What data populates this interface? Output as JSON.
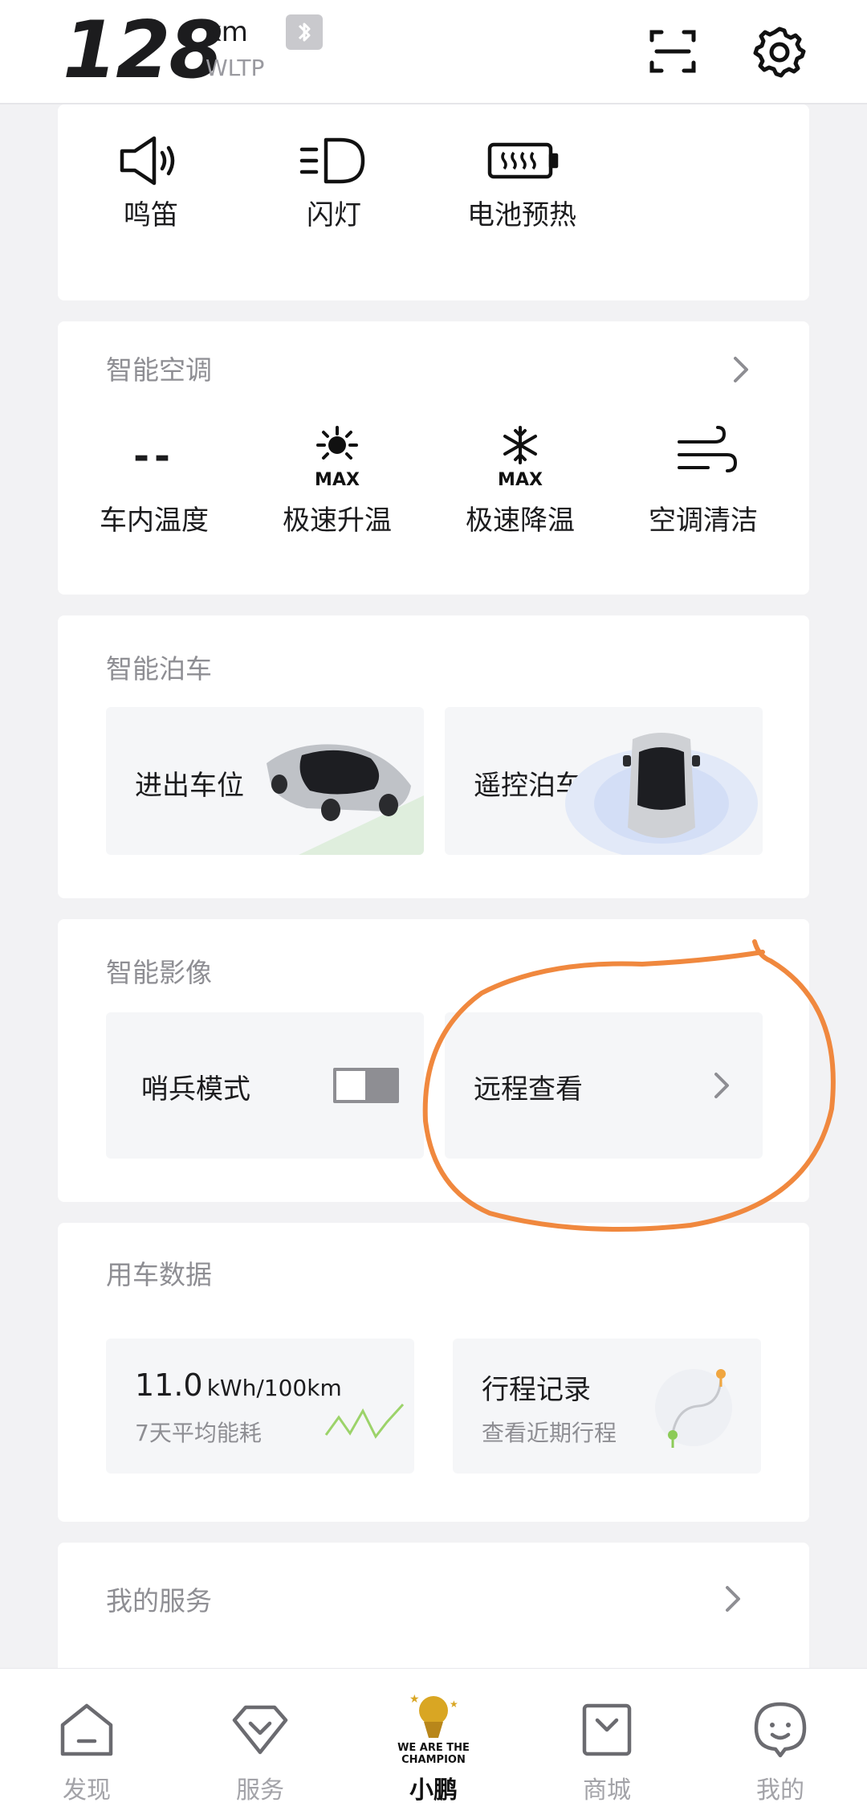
{
  "status": {
    "range_value": "128",
    "range_unit": "km",
    "range_standard": "WLTP"
  },
  "quick_actions": [
    {
      "label": "鸣笛",
      "icon": "horn-icon"
    },
    {
      "label": "闪灯",
      "icon": "headlight-icon"
    },
    {
      "label": "电池预热",
      "icon": "battery-heat-icon"
    }
  ],
  "climate": {
    "title": "智能空调",
    "items": [
      {
        "label": "车内温度",
        "value": "--",
        "icon": "temperature-dash-icon"
      },
      {
        "label": "极速升温",
        "icon": "sun-max-icon",
        "badge": "MAX"
      },
      {
        "label": "极速降温",
        "icon": "snowflake-max-icon",
        "badge": "MAX"
      },
      {
        "label": "空调清洁",
        "icon": "wind-icon"
      }
    ]
  },
  "parking": {
    "title": "智能泊车",
    "tiles": [
      {
        "label": "进出车位"
      },
      {
        "label": "遥控泊车"
      }
    ]
  },
  "camera": {
    "title": "智能影像",
    "sentry_label": "哨兵模式",
    "sentry_on": false,
    "remote_label": "远程查看"
  },
  "vehicle_data": {
    "title": "用车数据",
    "energy_value": "11.0",
    "energy_unit": "kWh/100km",
    "energy_caption": "7天平均能耗",
    "trip_title": "行程记录",
    "trip_caption": "查看近期行程"
  },
  "services": {
    "title": "我的服务"
  },
  "tabbar": {
    "items": [
      {
        "label": "发现",
        "icon": "home-icon",
        "active": false
      },
      {
        "label": "服务",
        "icon": "service-icon",
        "active": false
      },
      {
        "label": "小鹏",
        "icon": "champion-trophy-icon",
        "active": true,
        "badge_lines": [
          "WE ARE THE",
          "CHAMPION"
        ]
      },
      {
        "label": "商城",
        "icon": "shopping-bag-icon",
        "active": false
      },
      {
        "label": "我的",
        "icon": "profile-face-icon",
        "active": false
      }
    ]
  },
  "colors": {
    "accent_annotation": "#f0883e",
    "background": "#f2f2f4",
    "card": "#ffffff",
    "muted_text": "#8e8e93"
  }
}
